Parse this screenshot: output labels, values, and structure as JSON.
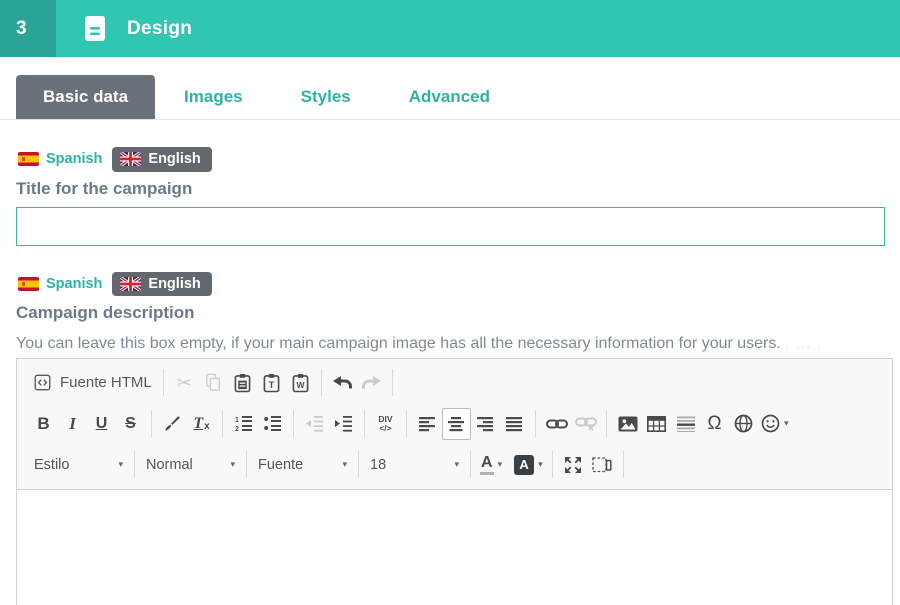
{
  "header": {
    "step_number": "3",
    "title": "Design"
  },
  "tabs": {
    "items": [
      {
        "label": "Basic data",
        "active": true
      },
      {
        "label": "Images",
        "active": false
      },
      {
        "label": "Styles",
        "active": false
      },
      {
        "label": "Advanced",
        "active": false
      }
    ]
  },
  "language_switcher": {
    "options": [
      {
        "label": "Spanish",
        "active": false
      },
      {
        "label": "English",
        "active": true
      }
    ]
  },
  "title_section": {
    "label": "Title for the campaign",
    "input_value": ""
  },
  "description_section": {
    "label": "Campaign description",
    "help_text": "You can leave this box empty, if your main campaign image has all the necessary information for your users.",
    "truncated_fragment": ". ... ."
  },
  "editor": {
    "source_button_label": "Fuente HTML",
    "style_dropdown": "Estilo",
    "format_dropdown": "Normal",
    "font_dropdown": "Fuente",
    "size_dropdown": "18",
    "content": ""
  },
  "icons": {
    "cut": "✂",
    "bold": "B",
    "italic": "I",
    "underline": "U",
    "strikethrough": "S",
    "removeformat_t": "T",
    "removeformat_x": "x",
    "div_top": "DIV",
    "div_bottom": "</>",
    "omega": "Ω",
    "color_letter": "A",
    "caret": "▾"
  },
  "colors": {
    "header_teal": "#31c6b2",
    "header_step_teal": "#2aa496",
    "active_tab_gray": "#6b7178",
    "teal_text": "#2cb3a6",
    "input_border": "#2dbbaf",
    "label_gray": "#6b7a8b",
    "help_gray": "#7f8a94",
    "badge_gray": "#63686e"
  }
}
